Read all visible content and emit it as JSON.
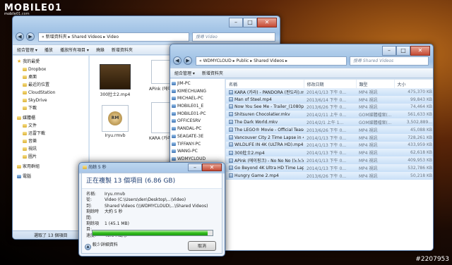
{
  "watermark": {
    "brand": "MOBILE01",
    "sub": "mobile01.com",
    "credit": "#2207953"
  },
  "back_window": {
    "address": "« 新增資料夾 ▸ Shared Videos ▸ Video",
    "search_placeholder": "搜尋 Video",
    "toolbar": [
      "組合管理 ▾",
      "播放",
      "播放所有項目 ▾",
      "燒錄",
      "新增資料夾"
    ],
    "nav": [
      {
        "label": "我的最愛",
        "header": true,
        "icon": "star-icon"
      },
      {
        "label": "Dropbox",
        "icon": "folder-icon"
      },
      {
        "label": "桌面",
        "icon": "folder-icon"
      },
      {
        "label": "最近的位置",
        "icon": "folder-icon"
      },
      {
        "label": "CloudStation",
        "icon": "folder-icon"
      },
      {
        "label": "SkyDrive",
        "icon": "folder-icon"
      },
      {
        "label": "下載",
        "icon": "folder-icon"
      },
      {
        "label": "媒體櫃",
        "header": true,
        "icon": "folder-icon"
      },
      {
        "label": "文件",
        "icon": "folder-icon"
      },
      {
        "label": "迅雷下載",
        "icon": "folder-icon"
      },
      {
        "label": "音樂",
        "icon": "folder-icon"
      },
      {
        "label": "視訊",
        "icon": "folder-icon"
      },
      {
        "label": "圖片",
        "icon": "folder-icon"
      },
      {
        "label": "家用群組",
        "header": true,
        "icon": "folder-icon"
      },
      {
        "label": "電腦",
        "header": true,
        "icon": "pc-icon"
      }
    ],
    "thumbs": [
      {
        "label": "300壯士2.mp4"
      },
      {
        "label": "APink (에이핑크) - No No No..."
      },
      {
        "label": "Iryu.rmvb"
      },
      {
        "label": "KARA (카라) - PANDORA (판도라).mp4"
      }
    ],
    "status": "選取了 13 個項目"
  },
  "front_window": {
    "address": "« WDMYCLOUD ▸ Public ▸ Shared Videos ▸",
    "search_placeholder": "搜尋 Shared Videos",
    "toolbar": [
      "組合管理 ▾",
      "新增資料夾"
    ],
    "network": [
      "JIM-PC",
      "KIMECHUANG",
      "MICHAEL-PC",
      "MOBILE01_E",
      "MOBILE01-PC",
      "OFFICESRV",
      "RANDAL-PC",
      "SEAGATE-3E",
      "TIFFANY-PC",
      "WANG-PC",
      "WDMYCLOUD"
    ],
    "columns": [
      "名稱",
      "修改日期",
      "類型",
      "大小"
    ],
    "files": [
      {
        "name": "KARA (카라) - PANDORA (판도라).mp4",
        "date": "2014/1/13 下午 0...",
        "type": "MP4 視訊",
        "size": "475,370 KB"
      },
      {
        "name": "Man of Steel.mp4",
        "date": "2013/6/14 下午 0...",
        "type": "MP4 視訊",
        "size": "99,843 KB"
      },
      {
        "name": "Now You See Me - Trailer_(1080p).mp4",
        "date": "2013/6/26 下午 0...",
        "type": "MP4 視訊",
        "size": "74,464 KB"
      },
      {
        "name": "Shitsuren Chocolatier.mkv",
        "date": "2014/2/11 上午 0...",
        "type": "GOM媒體檔案(...",
        "size": "561,633 KB"
      },
      {
        "name": "The Dark World.mkv",
        "date": "2014/2/1 上午 1...",
        "type": "GOM媒體檔案(...",
        "size": "3,502,889..."
      },
      {
        "name": "The LEGO® Movie - Official Teaser Tr...",
        "date": "2013/6/26 下午 0...",
        "type": "MP4 視訊",
        "size": "45,088 KB"
      },
      {
        "name": "Vancouver City 2 Time Lapse in 4K Ultr...",
        "date": "2014/1/13 下午 0...",
        "type": "MP4 視訊",
        "size": "728,261 KB"
      },
      {
        "name": "WILDLIFE IN 4K (ULTRA HD).mp4",
        "date": "2014/1/13 下午 0...",
        "type": "MP4 視訊",
        "size": "433,959 KB"
      },
      {
        "name": "300壯士2.mp4",
        "date": "2014/1/13 下午 0...",
        "type": "MP4 視訊",
        "size": "62,618 KB"
      },
      {
        "name": "APink (에이핑크) - No No No (노노노)...",
        "date": "2014/1/13 下午 0...",
        "type": "MP4 視訊",
        "size": "409,953 KB"
      },
      {
        "name": "Go Beyond 4K Ultra HD Time Lapse m...",
        "date": "2014/1/13 下午 0...",
        "type": "MP4 視訊",
        "size": "532,786 KB"
      },
      {
        "name": "Hungry Game 2.mp4",
        "date": "2013/6/26 下午 0...",
        "type": "MP4 視訊",
        "size": "50,218 KB"
      }
    ]
  },
  "copy_dialog": {
    "title": "尚餘 5 秒",
    "heading": "正在複製 13 個項目 (6.86 GB)",
    "rows": [
      {
        "k": "名稱:",
        "v": "Iryu.rmvb"
      },
      {
        "k": "從:",
        "v": "Video (C:\\Users\\den\\Desktop\\...\\Video)"
      },
      {
        "k": "到:",
        "v": "Shared Videos (\\\\WDMYCLOUD\\...\\Shared Videos)"
      },
      {
        "k": "剩餘時間:",
        "v": "大約 5 秒"
      },
      {
        "k": "剩餘項目:",
        "v": "1 (45.1 MB)"
      },
      {
        "k": "速度:",
        "v": "43.6 MB/秒"
      }
    ],
    "progress": 0.96,
    "less_info": "較少詳細資料",
    "cancel": "取消"
  }
}
